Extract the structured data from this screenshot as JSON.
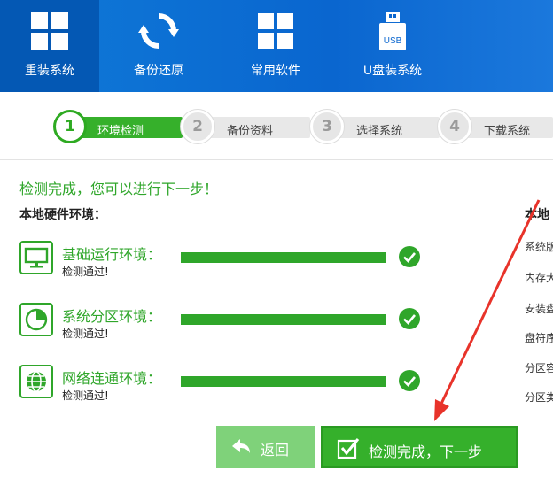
{
  "nav": {
    "items": [
      {
        "label": "重装系统",
        "icon": "windows-icon",
        "active": true
      },
      {
        "label": "备份还原",
        "icon": "sync-icon",
        "active": false
      },
      {
        "label": "常用软件",
        "icon": "apps-grid-icon",
        "active": false
      },
      {
        "label": "U盘装系统",
        "icon": "usb-drive-icon",
        "active": false
      }
    ],
    "usb_text": "USB"
  },
  "steps": [
    {
      "num": "1",
      "label": "环境检测",
      "active": true
    },
    {
      "num": "2",
      "label": "备份资料",
      "active": false
    },
    {
      "num": "3",
      "label": "选择系统",
      "active": false
    },
    {
      "num": "4",
      "label": "下载系统",
      "active": false
    }
  ],
  "status_message": "检测完成，您可以进行下一步！",
  "hardware_title": "本地硬件环境：",
  "checks": [
    {
      "name": "基础运行环境：",
      "result": "检测通过!",
      "progress": 1.0,
      "icon": "monitor-icon"
    },
    {
      "name": "系统分区环境：",
      "result": "检测通过!",
      "progress": 1.0,
      "icon": "pie-chart-icon"
    },
    {
      "name": "网络连通环境：",
      "result": "检测通过!",
      "progress": 1.0,
      "icon": "globe-icon"
    }
  ],
  "right_panel": {
    "title": "本地",
    "items": [
      "系统版",
      "内存大",
      "安装盘",
      "盘符序",
      "分区容",
      "分区类"
    ]
  },
  "buttons": {
    "back": "返回",
    "next": "检测完成，下一步"
  },
  "colors": {
    "nav_bg": "#0a66cf",
    "nav_active": "#0458b4",
    "accent_green": "#2fa62a",
    "annotation_red": "#e8332a"
  }
}
